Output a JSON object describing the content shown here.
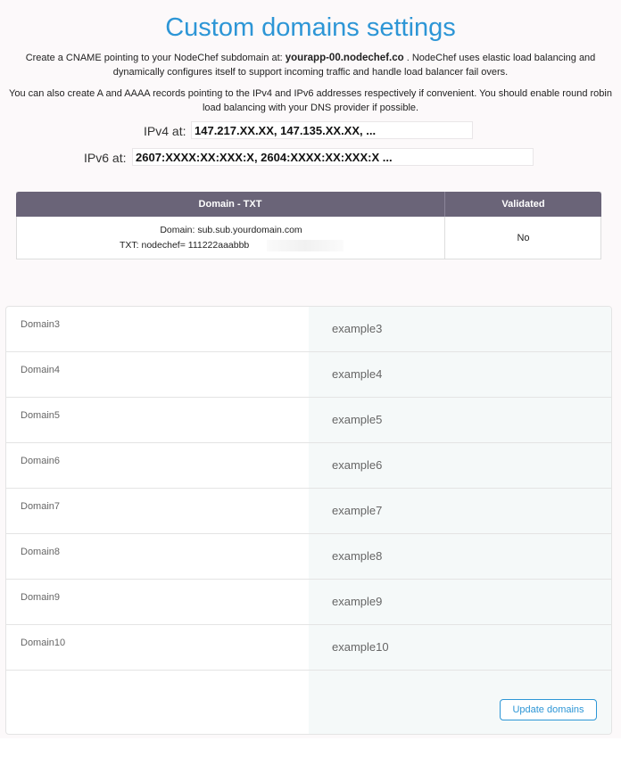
{
  "page": {
    "title": "Custom domains settings",
    "cname_prefix": "Create a CNAME pointing to your NodeChef subdomain at: ",
    "cname_host": "yourapp-00.nodechef.co",
    "cname_suffix": " . NodeChef uses elastic load balancing and dynamically configures itself to support incoming traffic and handle load balancer fail overs.",
    "records_note": "You can also create A and AAAA records pointing to the IPv4 and IPv6 addresses respectively if convenient. You should enable round robin load balancing with your DNS provider if possible.",
    "ipv4_label": "IPv4 at:",
    "ipv4_value": "147.217.XX.XX, 147.135.XX.XX, ...",
    "ipv6_label": "IPv6 at:",
    "ipv6_value": "2607:XXXX:XX:XXX:X, 2604:XXXX:XX:XXX:X ..."
  },
  "txt_table": {
    "headers": [
      "Domain - TXT",
      "Validated"
    ],
    "domain_line": "Domain: sub.sub.yourdomain.com",
    "txt_line": "TXT: nodechef= 111222aaabbb",
    "validated": "No"
  },
  "domains": [
    {
      "label": "Domain3",
      "value": "example3"
    },
    {
      "label": "Domain4",
      "value": "example4"
    },
    {
      "label": "Domain5",
      "value": "example5"
    },
    {
      "label": "Domain6",
      "value": "example6"
    },
    {
      "label": "Domain7",
      "value": "example7"
    },
    {
      "label": "Domain8",
      "value": "example8"
    },
    {
      "label": "Domain9",
      "value": "example9"
    },
    {
      "label": "Domain10",
      "value": "example10"
    }
  ],
  "update_button": "Update domains",
  "colors": {
    "title": "#2d96d6",
    "table_header": "#6a6478",
    "button_border": "#2d96d6"
  }
}
